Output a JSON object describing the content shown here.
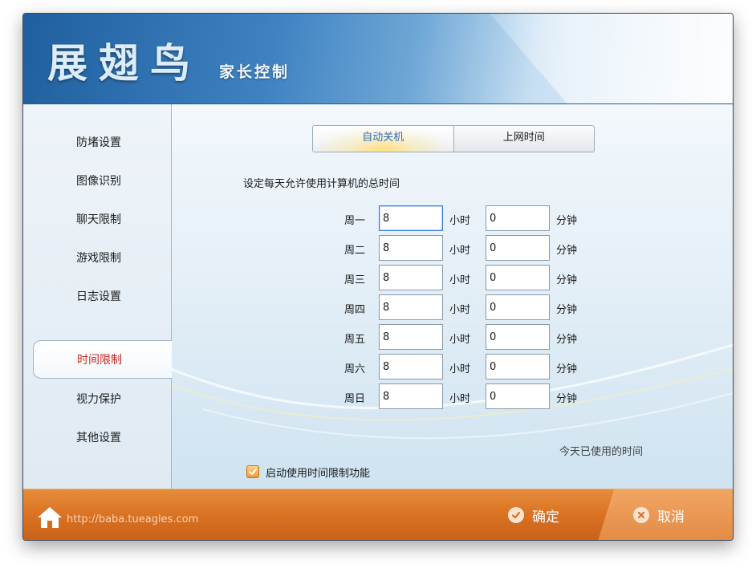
{
  "header": {
    "logo_main": "展翅鸟",
    "logo_sub": "家长控制"
  },
  "sidebar": {
    "items": [
      {
        "label": "防堵设置",
        "active": false
      },
      {
        "label": "图像识别",
        "active": false
      },
      {
        "label": "聊天限制",
        "active": false
      },
      {
        "label": "游戏限制",
        "active": false
      },
      {
        "label": "日志设置",
        "active": false
      },
      {
        "label": "时间限制",
        "active": true
      },
      {
        "label": "视力保护",
        "active": false
      },
      {
        "label": "其他设置",
        "active": false
      }
    ]
  },
  "tabs": [
    {
      "label": "自动关机",
      "active": true
    },
    {
      "label": "上网时间",
      "active": false
    }
  ],
  "schedule": {
    "section_label": "设定每天允许使用计算机的总时间",
    "hour_unit": "小时",
    "minute_unit": "分钟",
    "days": [
      {
        "label": "周一",
        "hours": "8",
        "minutes": "0"
      },
      {
        "label": "周二",
        "hours": "8",
        "minutes": "0"
      },
      {
        "label": "周三",
        "hours": "8",
        "minutes": "0"
      },
      {
        "label": "周四",
        "hours": "8",
        "minutes": "0"
      },
      {
        "label": "周五",
        "hours": "8",
        "minutes": "0"
      },
      {
        "label": "周六",
        "hours": "8",
        "minutes": "0"
      },
      {
        "label": "周日",
        "hours": "8",
        "minutes": "0"
      }
    ],
    "used_today_label": "今天已使用的时间",
    "enable_label": "启动使用时间限制功能",
    "enable_checked": true
  },
  "footer": {
    "url": "http://baba.tueagles.com",
    "ok_label": "确定",
    "cancel_label": "取消"
  },
  "colors": {
    "accent_blue": "#2b6cb8",
    "active_nav_text": "#c0281c",
    "footer_orange": "#db7424"
  }
}
